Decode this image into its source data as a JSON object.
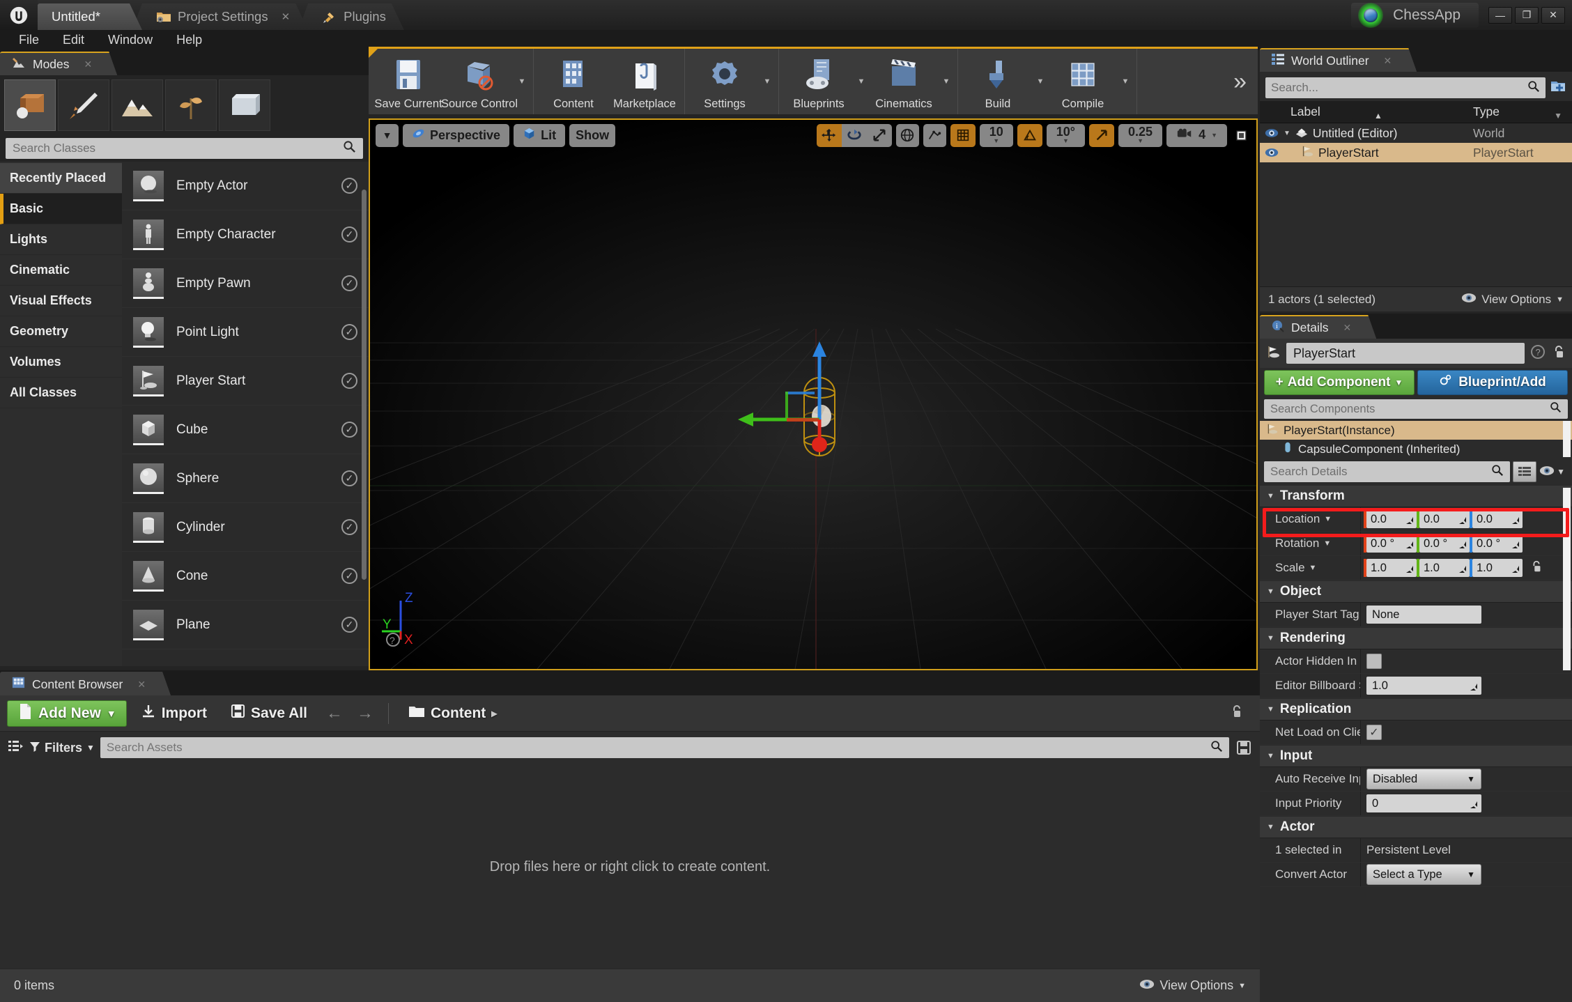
{
  "titlebar": {
    "tabs": [
      {
        "label": "Untitled*",
        "icon": "none",
        "active": true
      },
      {
        "label": "Project Settings",
        "icon": "folder-gear-icon",
        "active": false
      },
      {
        "label": "Plugins",
        "icon": "plug-icon",
        "active": false
      }
    ],
    "app_name": "ChessApp",
    "window_buttons": [
      "minimize",
      "restore",
      "close"
    ]
  },
  "menubar": {
    "items": [
      "File",
      "Edit",
      "Window",
      "Help"
    ]
  },
  "modes_panel": {
    "tab_label": "Modes",
    "mode_buttons": [
      "place-mode-icon",
      "paint-mode-icon",
      "landscape-mode-icon",
      "foliage-mode-icon",
      "geometry-edit-mode-icon"
    ],
    "search_placeholder": "Search Classes",
    "categories": [
      {
        "label": "Recently Placed",
        "state": "hover"
      },
      {
        "label": "Basic",
        "state": "active"
      },
      {
        "label": "Lights",
        "state": "normal"
      },
      {
        "label": "Cinematic",
        "state": "normal"
      },
      {
        "label": "Visual Effects",
        "state": "normal"
      },
      {
        "label": "Geometry",
        "state": "normal"
      },
      {
        "label": "Volumes",
        "state": "normal"
      },
      {
        "label": "All Classes",
        "state": "normal"
      }
    ],
    "items": [
      {
        "label": "Empty Actor",
        "icon": "sphere-thumb-icon"
      },
      {
        "label": "Empty Character",
        "icon": "character-thumb-icon"
      },
      {
        "label": "Empty Pawn",
        "icon": "pawn-thumb-icon"
      },
      {
        "label": "Point Light",
        "icon": "bulb-thumb-icon"
      },
      {
        "label": "Player Start",
        "icon": "playerstart-thumb-icon"
      },
      {
        "label": "Cube",
        "icon": "cube-thumb-icon"
      },
      {
        "label": "Sphere",
        "icon": "sphere2-thumb-icon"
      },
      {
        "label": "Cylinder",
        "icon": "cylinder-thumb-icon"
      },
      {
        "label": "Cone",
        "icon": "cone-thumb-icon"
      },
      {
        "label": "Plane",
        "icon": "plane-thumb-icon"
      }
    ]
  },
  "main_toolbar": {
    "groups": [
      {
        "buttons": [
          {
            "label": "Save Current",
            "icon": "floppy-icon",
            "caret": false
          },
          {
            "label": "Source Control",
            "icon": "source-control-icon",
            "caret": true
          }
        ]
      },
      {
        "buttons": [
          {
            "label": "Content",
            "icon": "content-icon",
            "caret": false
          },
          {
            "label": "Marketplace",
            "icon": "marketplace-icon",
            "caret": false
          }
        ]
      },
      {
        "buttons": [
          {
            "label": "Settings",
            "icon": "gear-icon",
            "caret": true
          }
        ]
      },
      {
        "buttons": [
          {
            "label": "Blueprints",
            "icon": "blueprints-icon",
            "caret": true
          },
          {
            "label": "Cinematics",
            "icon": "clapperboard-icon",
            "caret": true
          }
        ]
      },
      {
        "buttons": [
          {
            "label": "Build",
            "icon": "build-icon",
            "caret": true
          },
          {
            "label": "Compile",
            "icon": "compile-icon",
            "caret": true
          }
        ]
      }
    ],
    "overflow_label": "»"
  },
  "viewport": {
    "camera_menu_icon": "chevron-down-icon",
    "perspective_label": "Perspective",
    "lit_label": "Lit",
    "show_label": "Show",
    "transform_tools": [
      "translate-gizmo-icon",
      "rotate-gizmo-icon",
      "scale-gizmo-icon"
    ],
    "world_space_icon": "globe-icon",
    "surface_snap_icon": "surface-snap-icon",
    "grid_snap_icon": "grid-snap-icon",
    "grid_snap_value": "10",
    "angle_snap_icon": "angle-snap-icon",
    "angle_snap_value": "10°",
    "scale_snap_icon": "scale-snap-icon",
    "scale_snap_value": "0.25",
    "camera_speed_icon": "camera-speed-icon",
    "camera_speed_value": "4",
    "maximize_icon": "maximize-viewport-icon",
    "axis_labels": {
      "x": "X",
      "y": "Y",
      "z": "Z"
    },
    "selected_actor": "PlayerStart"
  },
  "world_outliner": {
    "tab_label": "World Outliner",
    "search_placeholder": "Search...",
    "add_icon": "add-folder-icon",
    "columns": [
      "Label",
      "Type"
    ],
    "rows": [
      {
        "label": "Untitled (Editor)",
        "type": "World",
        "icon": "world-icon",
        "selected": false,
        "depth": 0,
        "expanded": true
      },
      {
        "label": "PlayerStart",
        "type": "PlayerStart",
        "icon": "playerstart-icon",
        "selected": true,
        "depth": 1,
        "expanded": false
      }
    ],
    "status": "1 actors (1 selected)",
    "view_options_label": "View Options"
  },
  "details_panel": {
    "tab_label": "Details",
    "actor_name": "PlayerStart",
    "help_icon": "help-icon",
    "lock_icon": "unlock-icon",
    "add_component_label": "Add Component",
    "blueprint_label": "Blueprint/Add",
    "search_components_placeholder": "Search Components",
    "components": [
      {
        "label": "PlayerStart(Instance)",
        "icon": "playerstart-icon",
        "selected": true,
        "indent": false
      },
      {
        "label": "CapsuleComponent (Inherited)",
        "icon": "capsule-icon",
        "selected": false,
        "indent": true
      }
    ],
    "search_details_placeholder": "Search Details",
    "sections": [
      {
        "name": "Transform",
        "rows": [
          {
            "label": "Location",
            "caret": true,
            "type": "vec3",
            "values": [
              "0.0",
              "0.0",
              "0.0"
            ],
            "highlight": true
          },
          {
            "label": "Rotation",
            "caret": true,
            "type": "vec3",
            "values": [
              "0.0 °",
              "0.0 °",
              "0.0 °"
            ],
            "highlight": false
          },
          {
            "label": "Scale",
            "caret": true,
            "type": "vec3-lock",
            "values": [
              "1.0",
              "1.0",
              "1.0"
            ],
            "highlight": false
          }
        ]
      },
      {
        "name": "Object",
        "rows": [
          {
            "label": "Player Start Tag",
            "caret": false,
            "type": "text",
            "values": [
              "None"
            ],
            "highlight": false
          }
        ]
      },
      {
        "name": "Rendering",
        "rows": [
          {
            "label": "Actor Hidden In G",
            "caret": false,
            "type": "checkbox",
            "values": [
              "unchecked"
            ],
            "highlight": false
          },
          {
            "label": "Editor Billboard S",
            "caret": false,
            "type": "number",
            "values": [
              "1.0"
            ],
            "highlight": false
          }
        ]
      },
      {
        "name": "Replication",
        "rows": [
          {
            "label": "Net Load on Clien",
            "caret": false,
            "type": "checkbox",
            "values": [
              "checked"
            ],
            "highlight": false
          }
        ]
      },
      {
        "name": "Input",
        "rows": [
          {
            "label": "Auto Receive Inpu",
            "caret": false,
            "type": "combo",
            "values": [
              "Disabled"
            ],
            "highlight": false
          },
          {
            "label": "Input Priority",
            "caret": false,
            "type": "number",
            "values": [
              "0"
            ],
            "highlight": false
          }
        ]
      },
      {
        "name": "Actor",
        "rows": [
          {
            "label": "1 selected in",
            "caret": false,
            "type": "plain",
            "values": [
              "Persistent Level"
            ],
            "highlight": false
          },
          {
            "label": "Convert Actor",
            "caret": false,
            "type": "combo",
            "values": [
              "Select a Type"
            ],
            "highlight": false
          }
        ]
      }
    ]
  },
  "content_browser": {
    "tab_label": "Content Browser",
    "add_new_label": "Add New",
    "import_label": "Import",
    "save_all_label": "Save All",
    "back_icon": "arrow-left-icon",
    "forward_icon": "arrow-right-icon",
    "breadcrumb": [
      "Content"
    ],
    "breadcrumb_arrow": "▸",
    "filters_label": "Filters",
    "search_placeholder": "Search Assets",
    "empty_message": "Drop files here or right click to create content.",
    "item_count": "0 items",
    "view_options_label": "View Options"
  },
  "colors": {
    "accent_orange": "#e0a118",
    "selection_tan": "#d9b98b",
    "green_button": "#5aa63c",
    "blue_button": "#24649c",
    "highlight_red": "#f41c1c",
    "axis_x": "#e0421a",
    "axis_y": "#63b518",
    "axis_z": "#2b84e0"
  }
}
